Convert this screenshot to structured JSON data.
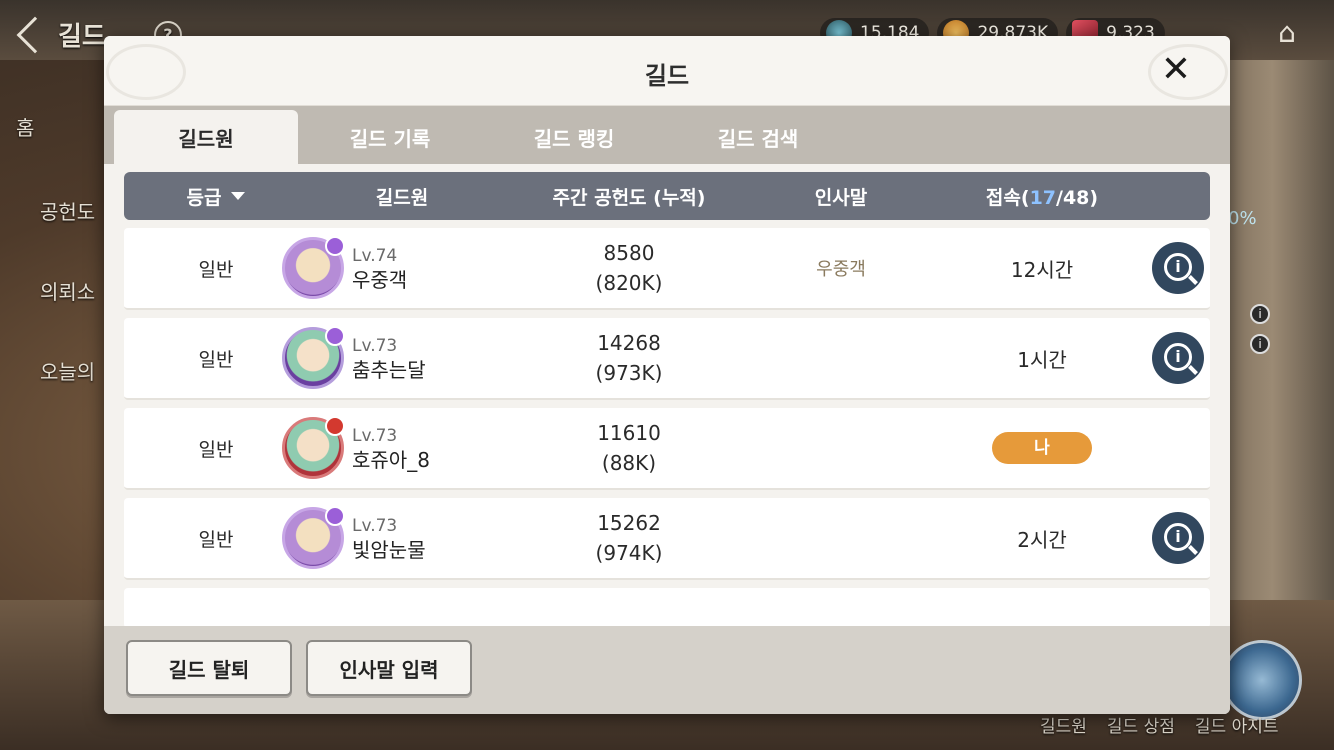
{
  "background": {
    "top_left_title": "길드",
    "currencies": [
      "15,184",
      "29,873K",
      "9,323"
    ],
    "side_menu": [
      "홈",
      "공헌도",
      "의뢰소",
      "오늘의"
    ],
    "right_percent": "0%",
    "bottom_nav": [
      "길드원",
      "길드 상점",
      "길드 아지트"
    ]
  },
  "dialog": {
    "title": "길드",
    "close_label": "✕",
    "tabs": [
      "길드원",
      "길드 기록",
      "길드 랭킹",
      "길드 검색"
    ],
    "active_tab": 0,
    "columns": {
      "grade": "등급",
      "member": "길드원",
      "contribution": "주간 공헌도 (누적)",
      "greeting": "인사말",
      "login_prefix": "접속(",
      "online": "17",
      "login_suffix": "/48)"
    },
    "members": [
      {
        "grade": "일반",
        "level": "Lv.74",
        "name": "우중객",
        "weekly": "8580",
        "total": "(820K)",
        "greeting": "우중객",
        "login": "12시간",
        "is_me": false
      },
      {
        "grade": "일반",
        "level": "Lv.73",
        "name": "춤추는달",
        "weekly": "14268",
        "total": "(973K)",
        "greeting": "",
        "login": "1시간",
        "is_me": false
      },
      {
        "grade": "일반",
        "level": "Lv.73",
        "name": "호쥬아_8",
        "weekly": "11610",
        "total": "(88K)",
        "greeting": "",
        "login": "나",
        "is_me": true
      },
      {
        "grade": "일반",
        "level": "Lv.73",
        "name": "빛암눈물",
        "weekly": "15262",
        "total": "(974K)",
        "greeting": "",
        "login": "2시간",
        "is_me": false
      }
    ],
    "footer": {
      "leave_button": "길드 탈퇴",
      "greeting_button": "인사말 입력"
    }
  },
  "colors": {
    "header_bar": "#6b707c",
    "online_count": "#8ec2ff",
    "me_badge": "#e69a3a",
    "profile_button": "#31475e"
  }
}
